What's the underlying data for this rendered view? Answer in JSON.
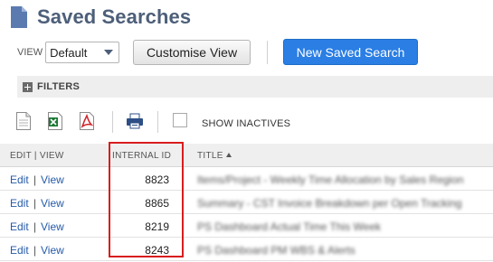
{
  "header": {
    "title": "Saved Searches",
    "icon": "document-icon"
  },
  "view": {
    "label": "VIEW",
    "selected": "Default"
  },
  "buttons": {
    "customise": "Customise View",
    "new_search": "New Saved Search"
  },
  "filters": {
    "label": "FILTERS"
  },
  "toolbar": {
    "show_inactives": "SHOW INACTIVES"
  },
  "table": {
    "headers": {
      "edit_view": "EDIT | VIEW",
      "internal_id": "INTERNAL ID",
      "title": "TITLE"
    },
    "rows": [
      {
        "edit": "Edit",
        "sep": "|",
        "view": "View",
        "id": "8823",
        "title": "Items/Project - Weekly Time Allocation by Sales Region"
      },
      {
        "edit": "Edit",
        "sep": "|",
        "view": "View",
        "id": "8865",
        "title": "Summary - CST Invoice Breakdown per Open Tracking"
      },
      {
        "edit": "Edit",
        "sep": "|",
        "view": "View",
        "id": "8219",
        "title": "PS Dashboard Actual Time This Week"
      },
      {
        "edit": "Edit",
        "sep": "|",
        "view": "View",
        "id": "8243",
        "title": "PS Dashboard PM WBS & Alerts"
      }
    ]
  },
  "colors": {
    "accent": "#2a7ee4",
    "title": "#4d5f79",
    "highlight": "#d81d1d",
    "link": "#255aa8"
  }
}
